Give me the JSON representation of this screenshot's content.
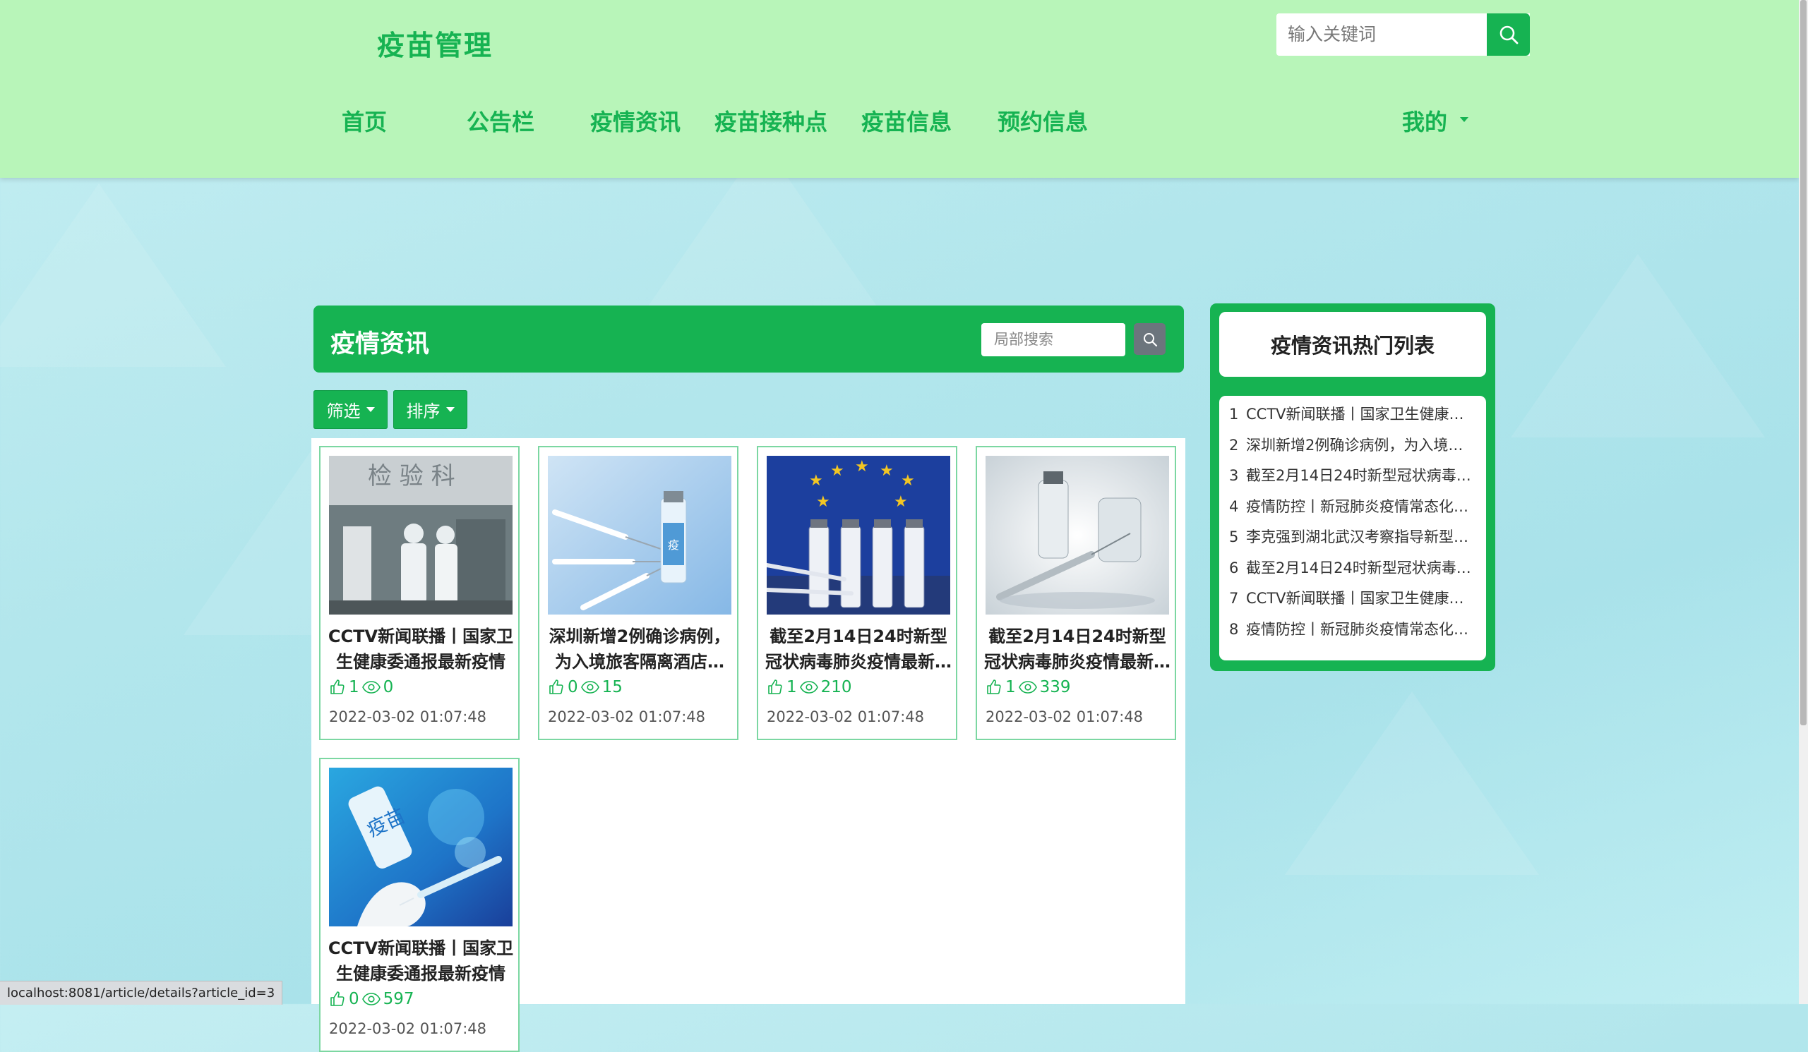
{
  "header": {
    "brand": "疫苗管理",
    "search_placeholder": "输入关键词",
    "nav": [
      "首页",
      "公告栏",
      "疫情资讯",
      "疫苗接种点",
      "疫苗信息",
      "预约信息"
    ],
    "user_menu": "我的"
  },
  "panel": {
    "title": "疫情资讯",
    "local_search_placeholder": "局部搜索",
    "filter_label": "筛选",
    "sort_label": "排序"
  },
  "cards": [
    {
      "title": "CCTV新闻联播丨国家卫生健康委通报最新疫情",
      "likes": "1",
      "views": "0",
      "date": "2022-03-02 01:07:48",
      "image": "lab-workers"
    },
    {
      "title": "深圳新增2例确诊病例，为入境旅客隔离酒店…",
      "likes": "0",
      "views": "15",
      "date": "2022-03-02 01:07:48",
      "image": "syringes-vial"
    },
    {
      "title": "截至2月14日24时新型冠状病毒肺炎疫情最新…",
      "likes": "1",
      "views": "210",
      "date": "2022-03-02 01:07:48",
      "image": "eu-vaccines"
    },
    {
      "title": "截至2月14日24时新型冠状病毒肺炎疫情最新…",
      "likes": "1",
      "views": "339",
      "date": "2022-03-02 01:07:48",
      "image": "vial-syringe"
    },
    {
      "title": "CCTV新闻联播丨国家卫生健康委通报最新疫情",
      "likes": "0",
      "views": "597",
      "date": "2022-03-02 01:07:48",
      "image": "vaccine-hand"
    }
  ],
  "sidebar": {
    "title": "疫情资讯热门列表",
    "items": [
      "CCTV新闻联播丨国家卫生健康…",
      "深圳新增2例确诊病例，为入境…",
      "截至2月14日24时新型冠状病毒…",
      "疫情防控丨新冠肺炎疫情常态化…",
      "李克强到湖北武汉考察指导新型…",
      "截至2月14日24时新型冠状病毒…",
      "CCTV新闻联播丨国家卫生健康…",
      "疫情防控丨新冠肺炎疫情常态化…"
    ]
  },
  "status_url": "localhost:8081/article/details?article_id=3",
  "colors": {
    "accent": "#16b352",
    "header_bg": "#b8f5b9",
    "card_border": "#7cd7a2"
  }
}
